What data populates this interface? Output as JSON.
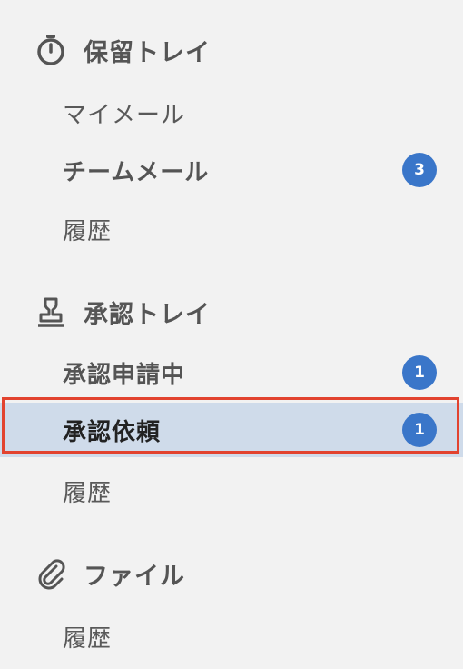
{
  "sections": [
    {
      "title": "保留トレイ",
      "icon": "stopwatch-icon",
      "items": [
        {
          "label": "マイメール",
          "badge": null
        },
        {
          "label": "チームメール",
          "badge": "3"
        },
        {
          "label": "履歴",
          "badge": null
        }
      ]
    },
    {
      "title": "承認トレイ",
      "icon": "stamp-icon",
      "items": [
        {
          "label": "承認申請中",
          "badge": "1"
        },
        {
          "label": "承認依頼",
          "badge": "1",
          "selected": true
        },
        {
          "label": "履歴",
          "badge": null
        }
      ]
    },
    {
      "title": "ファイル",
      "icon": "paperclip-icon",
      "items": [
        {
          "label": "履歴",
          "badge": null
        }
      ]
    }
  ],
  "colors": {
    "badge": "#3a76c9",
    "selected_bg": "#cfdbea",
    "highlight_outline": "#e2432f"
  }
}
